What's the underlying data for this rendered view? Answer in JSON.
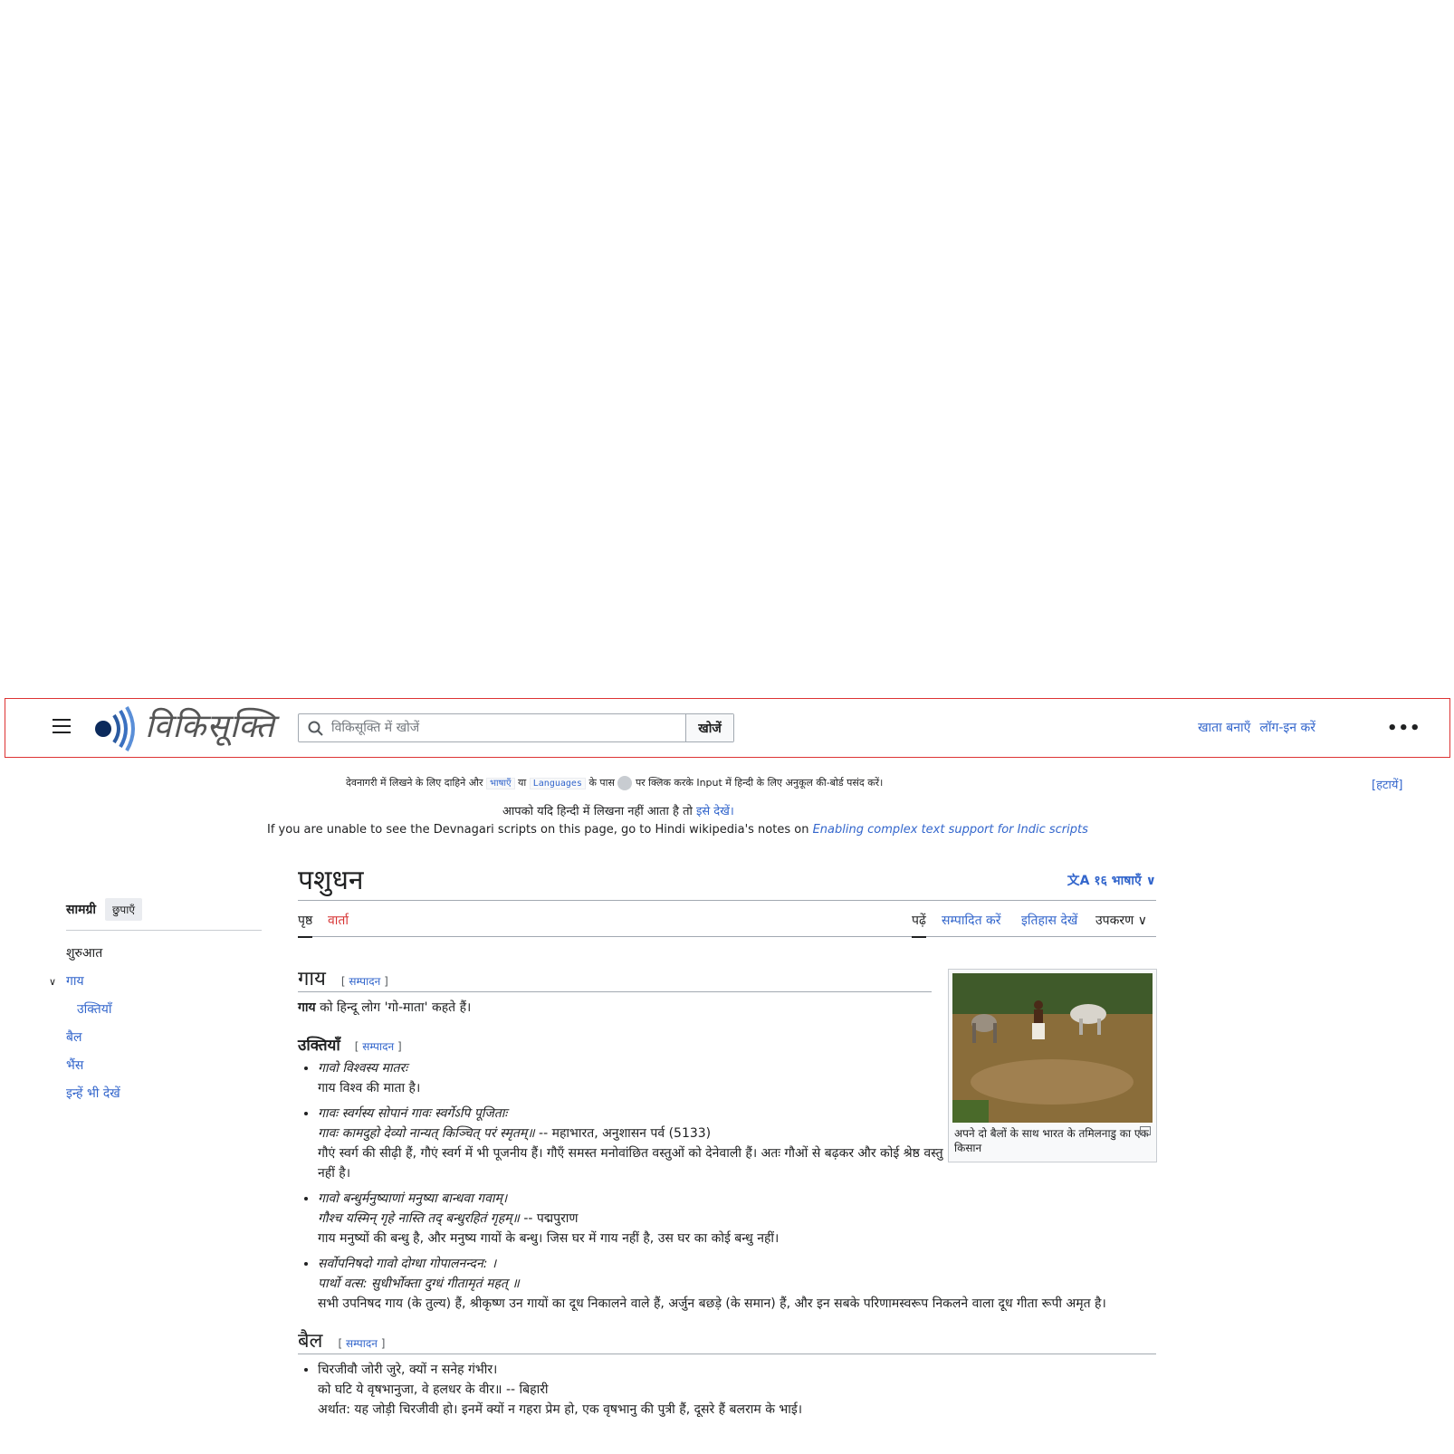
{
  "header": {
    "logo_text": "विकिसूक्ति",
    "search_placeholder": "विकिसूक्ति में खोजें",
    "search_button": "खोजें",
    "create_account": "खाता बनाएँ",
    "login": "लॉग-इन करें",
    "more": "•••"
  },
  "notice": {
    "line1_a": "देवनागरी में लिखने के लिए दाहिने और",
    "line1_code1": "भाषाएँ",
    "line1_b": "या",
    "line1_code2": "Languages",
    "line1_c": "के पास",
    "line1_d": "पर क्लिक करके Input में हिन्दी के लिए अनुकूल की-बोर्ड पसंद करें।",
    "hide": "[हटायें]",
    "line2_a": "आपको यदि हिन्दी में लिखना नहीं आता है तो",
    "line2_link": "इसे देखें।",
    "line3_a": "If you are unable to see the Devnagari scripts on this page, go to Hindi wikipedia's notes on",
    "line3_link": "Enabling complex text support for Indic scripts"
  },
  "toc": {
    "title": "सामग्री",
    "hide": "छुपाएँ",
    "items": [
      "शुरुआत",
      "गाय",
      "उक्तियाँ",
      "बैल",
      "भैंस",
      "इन्हें भी देखें"
    ]
  },
  "page": {
    "title": "पशुधन",
    "languages": "१६ भाषाएँ",
    "tab_page": "पृष्ठ",
    "tab_talk": "वार्ता",
    "tab_read": "पढ़ें",
    "tab_edit": "सम्पादित करें",
    "tab_history": "इतिहास देखें",
    "tab_tools": "उपकरण"
  },
  "sections": {
    "edit": "सम्पादन",
    "cow_heading": "गाय",
    "cow_intro_bold": "गाय",
    "cow_intro_rest": "को हिन्दू लोग 'गो-माता' कहते हैं।",
    "quotes_heading": "उक्तियाँ",
    "q1_sk": "गावो विश्वस्य मातरः",
    "q1_hi": "गाय विश्व की माता है।",
    "q2_sk1": "गावः स्वर्गस्य सोपानं गावः स्वर्गेऽपि पूजिताः",
    "q2_sk2": "गावः कामदुहो देव्यो नान्यत् किञ्चित् परं स्मृतम्॥",
    "q2_src": "-- महाभारत, अनुशासन पर्व (5133)",
    "q2_hi": "गौएं स्वर्ग की सीढ़ी हैं, गौएं स्वर्ग में भी पूजनीय हैं। गौएँ समस्त मनोवांछित वस्तुओं को देनेवाली हैं। अतः गौओं से बढ़कर और कोई श्रेष्ठ वस्तु नहीं है।",
    "q3_sk1": "गावो बन्धुर्मनुष्याणां मनुष्या बान्धवा गवाम्।",
    "q3_sk2": "गौश्च यस्मिन् गृहे नास्ति तद् बन्धुरहितं गृहम्॥",
    "q3_src": "-- पद्मपुराण",
    "q3_hi": "गाय मनुष्यों की बन्धु है, और मनुष्य गायों के बन्धु। जिस घर में गाय नहीं है, उस घर का कोई बन्धु नहीं।",
    "q4_sk1": "सर्वोपनिषदो गावो दोग्धा गोपालनन्दन: ।",
    "q4_sk2": "पार्थो वत्स: सुधीर्भोक्ता दुग्धं गीतामृतं महत् ॥",
    "q4_hi": "सभी उपनिषद गाय (के तुल्य) हैं, श्रीकृष्ण उन गायों का दूध निकालने वाले हैं, अर्जुन बछड़े (के समान) हैं, और इन सबके परिणामस्वरूप निकलने वाला दूध गीता रूपी अमृत है।",
    "ox_heading": "बैल",
    "o1_l1": "चिरजीवौ जोरी जुरे, क्यों न सनेह गंभीर।",
    "o1_l2": "को घटि ये वृषभानुजा, वे हलधर के वीर॥",
    "o1_src": "-- बिहारी",
    "o1_hi": "अर्थात: यह जोड़ी चिरजीवी हो। इनमें क्यों न गहरा प्रेम हो, एक वृषभानु की पुत्री हैं, दूसरे हैं बलराम के भाई।"
  },
  "image": {
    "caption": "अपने दो बैलों के साथ भारत के तमिलनाडु का एक किसान"
  }
}
